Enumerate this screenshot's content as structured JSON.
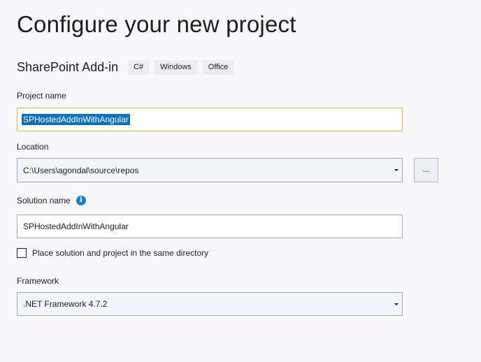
{
  "header": {
    "title": "Configure your new project"
  },
  "template": {
    "name": "SharePoint Add-in",
    "tags": [
      "C#",
      "Windows",
      "Office"
    ]
  },
  "project_name": {
    "label": "Project name",
    "value": "SPHostedAddInWithAngular"
  },
  "location": {
    "label": "Location",
    "value": "C:\\Users\\agondal\\source\\repos",
    "browse_label": "..."
  },
  "solution_name": {
    "label": "Solution name",
    "info_glyph": "i",
    "value": "SPHostedAddInWithAngular"
  },
  "same_directory": {
    "label": "Place solution and project in the same directory",
    "checked": false
  },
  "framework": {
    "label": "Framework",
    "value": ".NET Framework 4.7.2"
  },
  "colors": {
    "accent": "#0e70c0",
    "focus_border": "#e0b240",
    "info": "#1b80d6"
  }
}
